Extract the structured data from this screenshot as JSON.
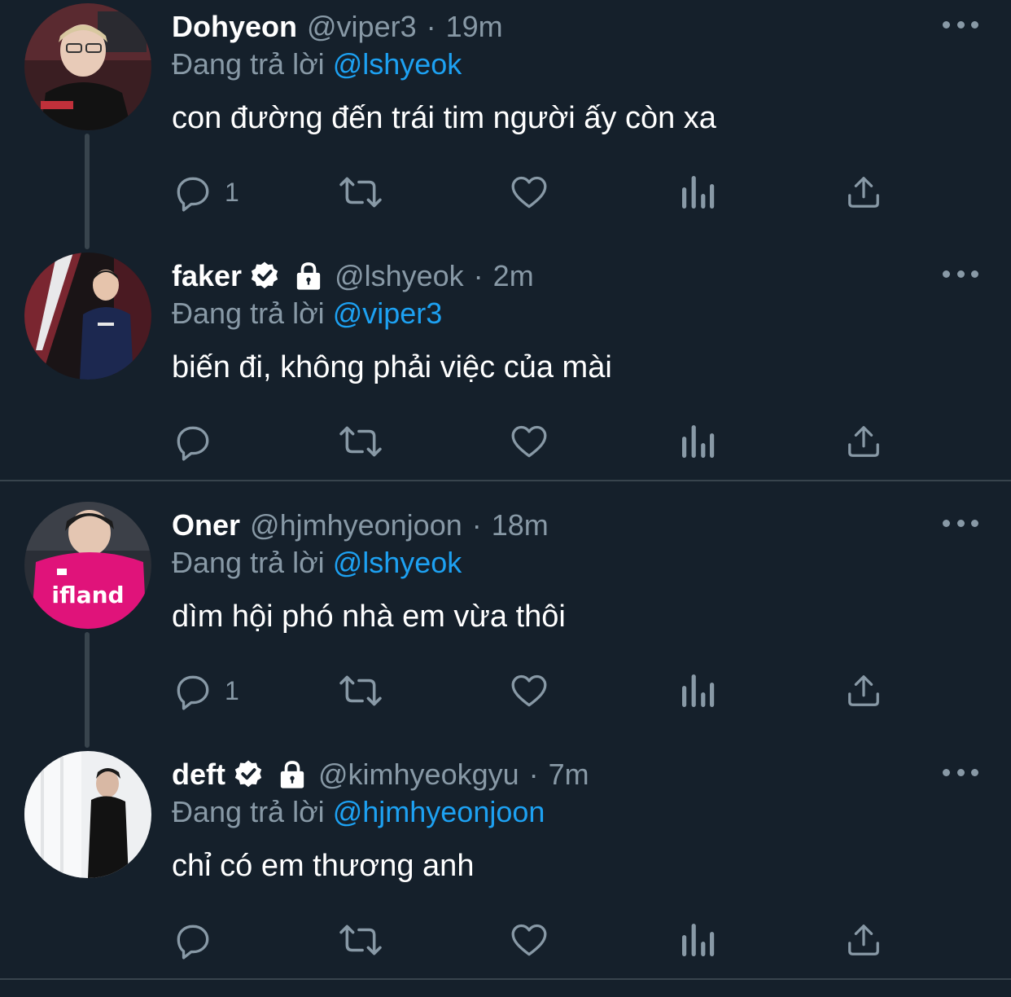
{
  "reply_prefix": "Đang trả lời",
  "colors": {
    "background": "#15202b",
    "text": "#ffffff",
    "secondary": "#8899a6",
    "link": "#1da1f2",
    "separator": "#38444d"
  },
  "tweets": [
    {
      "name": "Dohyeon",
      "handle": "@viper3",
      "time": "19m",
      "separator": "·",
      "replying_to": "@lshyeok",
      "text": "con đường đến trái tim người ấy còn xa",
      "reply_count": "1",
      "verified": false,
      "protected": false,
      "avatar": "avatar-dohyeon"
    },
    {
      "name": "faker",
      "handle": "@lshyeok",
      "time": "2m",
      "separator": "·",
      "replying_to": "@viper3",
      "text": "biến đi, không phải việc của mài",
      "reply_count": "",
      "verified": true,
      "protected": true,
      "avatar": "avatar-faker"
    },
    {
      "name": "Oner",
      "handle": "@hjmhyeonjoon",
      "time": "18m",
      "separator": "·",
      "replying_to": "@lshyeok",
      "text": "dìm hội phó nhà em vừa thôi",
      "reply_count": "1",
      "verified": false,
      "protected": false,
      "avatar": "avatar-oner"
    },
    {
      "name": "deft",
      "handle": "@kimhyeokgyu",
      "time": "7m",
      "separator": "·",
      "replying_to": "@hjmhyeonjoon",
      "text": "chỉ có em thương anh",
      "reply_count": "",
      "verified": true,
      "protected": true,
      "avatar": "avatar-deft"
    }
  ],
  "avatar_logo_text": "ifland",
  "icons": [
    "reply-icon",
    "retweet-icon",
    "like-icon",
    "analytics-icon",
    "share-icon",
    "more-icon",
    "verified-badge-icon",
    "lock-icon"
  ]
}
